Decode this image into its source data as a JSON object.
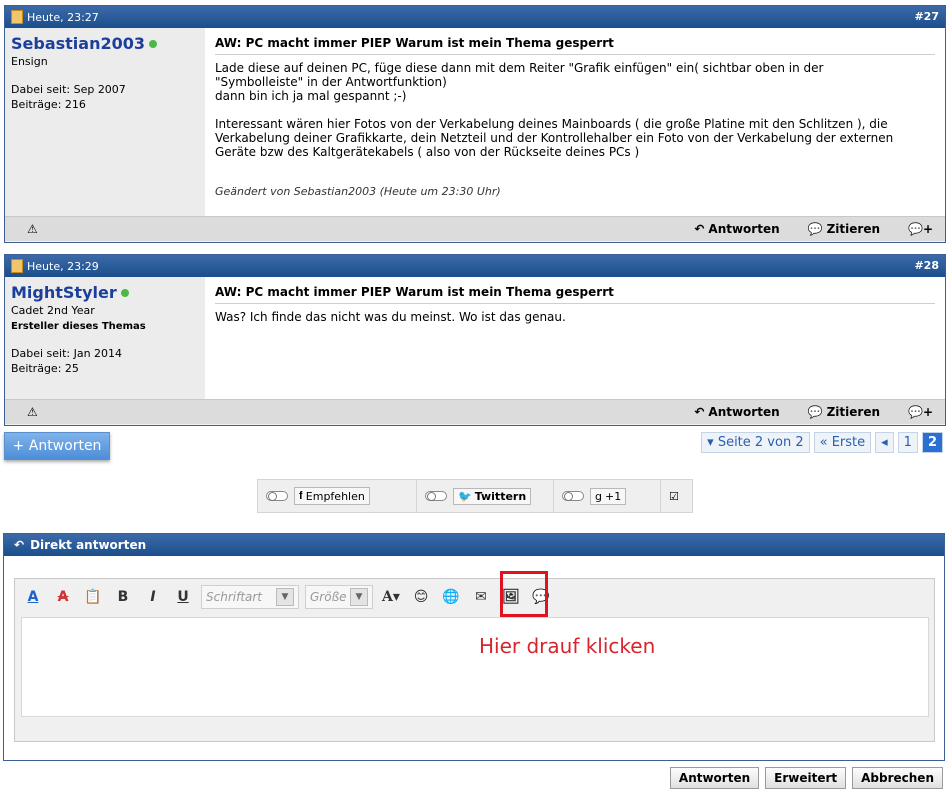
{
  "posts": [
    {
      "date": "Heute, 23:27",
      "number": "#27",
      "username": "Sebastian2003",
      "rank": "Ensign",
      "creator": "",
      "joined": "Dabei seit: Sep 2007",
      "posts_count": "Beiträge: 216",
      "title": "AW: PC macht immer PIEP Warum ist mein Thema gesperrt",
      "text": "Lade diese auf deinen PC, füge diese dann mit dem Reiter \"Grafik einfügen\" ein( sichtbar oben in der\n\"Symbolleiste\" in der Antwortfunktion)\ndann bin ich ja mal gespannt ;-)\n\nInteressant wären hier Fotos von der Verkabelung deines Mainboards ( die große Platine mit den Schlitzen ), die\nVerkabelung deiner Grafikkarte, dein Netzteil und der Kontrollehalber ein Foto von der Verkabelung der externen\nGeräte bzw des Kaltgerätekabels ( also von der Rückseite deines PCs )",
      "edited": "Geändert von Sebastian2003 (Heute um 23:30 Uhr)"
    },
    {
      "date": "Heute, 23:29",
      "number": "#28",
      "username": "MightStyler",
      "rank": "Cadet 2nd Year",
      "creator": "Ersteller dieses Themas",
      "joined": "Dabei seit: Jan 2014",
      "posts_count": "Beiträge: 25",
      "title": "AW: PC macht immer PIEP Warum ist mein Thema gesperrt",
      "text": "Was? Ich finde das nicht was du meinst. Wo ist das genau.",
      "edited": ""
    }
  ],
  "post_actions": {
    "reply": "Antworten",
    "quote": "Zitieren"
  },
  "reply_button": "+ Antworten",
  "pagination": {
    "page_label": "Seite 2 von 2",
    "first": "Erste",
    "page1": "1",
    "page2": "2"
  },
  "social": {
    "facebook": "Empfehlen",
    "twitter": "Twittern",
    "google": "+1"
  },
  "reply_box": {
    "title": "Direkt antworten",
    "font_placeholder": "Schriftart",
    "size_placeholder": "Größe"
  },
  "hint": "Hier drauf klicken",
  "form_buttons": {
    "submit": "Antworten",
    "advanced": "Erweitert",
    "cancel": "Abbrechen"
  },
  "colors": {
    "header": "#1b4e8c",
    "accent": "#2a6fd2",
    "highlight": "#e0141e"
  }
}
